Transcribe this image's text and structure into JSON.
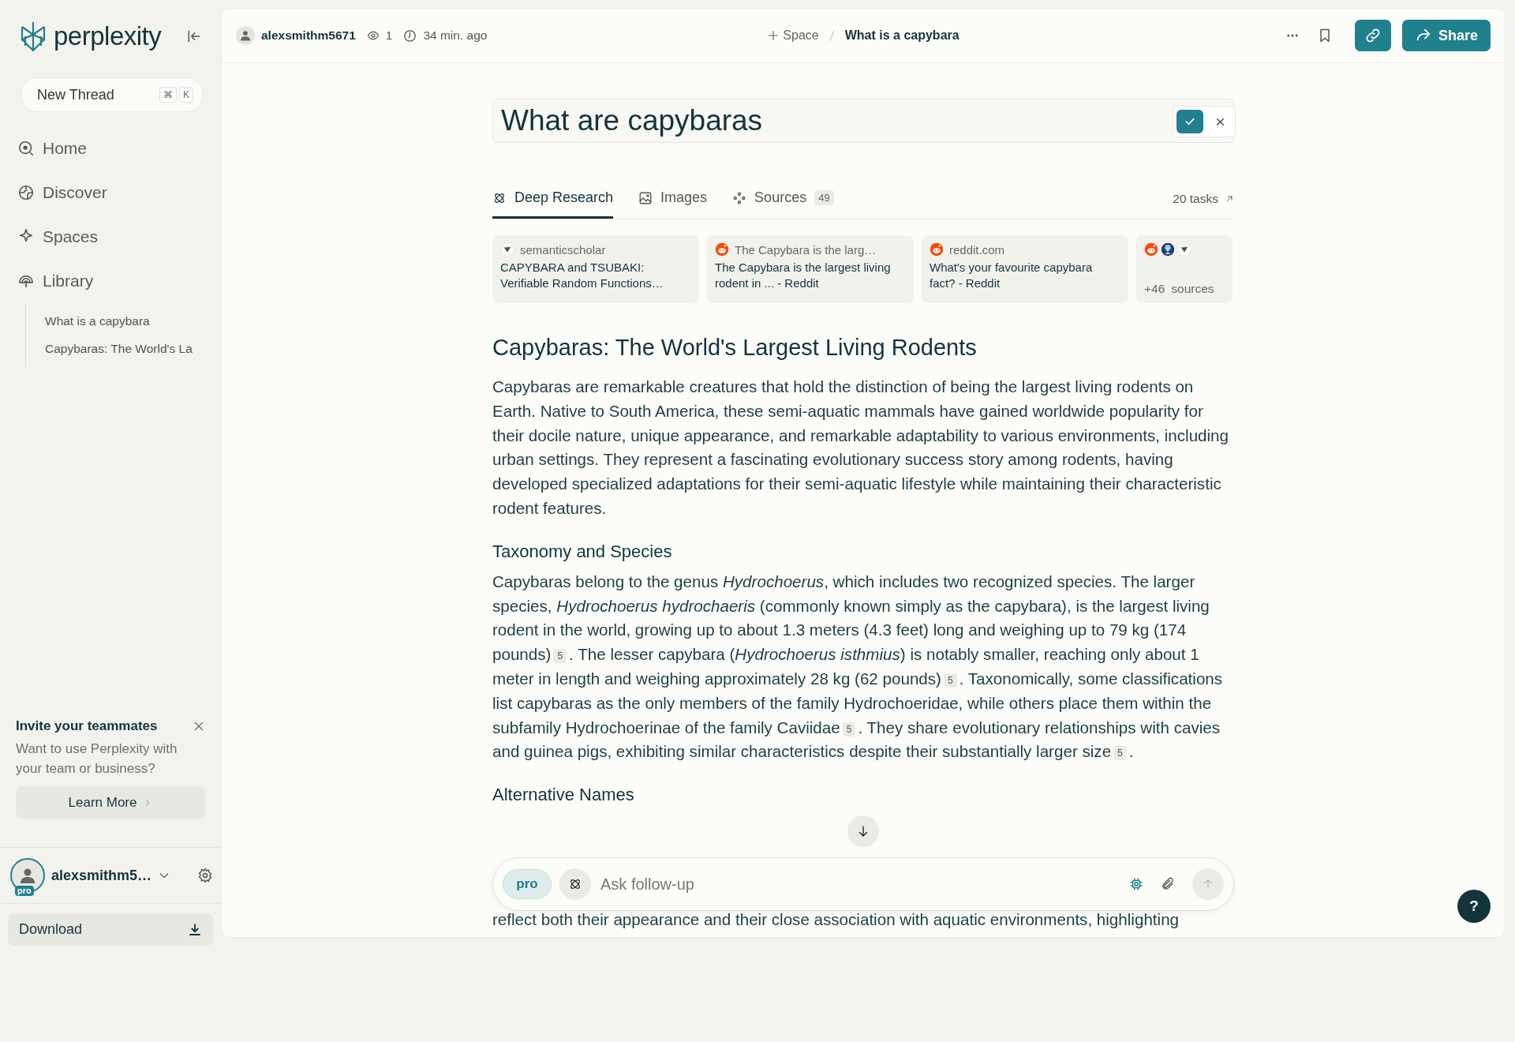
{
  "sidebar": {
    "logo": "perplexity",
    "new_thread": {
      "label": "New Thread",
      "keys": [
        "⌘",
        "K"
      ]
    },
    "nav": [
      {
        "label": "Home",
        "kind": "home"
      },
      {
        "label": "Discover",
        "kind": "discover"
      },
      {
        "label": "Spaces",
        "kind": "spaces"
      },
      {
        "label": "Library",
        "kind": "library"
      }
    ],
    "library_items": [
      "What is a capybara",
      "Capybaras: The World's La"
    ],
    "invite": {
      "title": "Invite your teammates",
      "text": "Want to use Perplexity with your team or business?",
      "button": "Learn More"
    },
    "user": {
      "name": "alexsmithm5…",
      "badge": "pro"
    },
    "download": "Download"
  },
  "header": {
    "author": "alexsmithm5671",
    "views": "1",
    "time": "34 min. ago",
    "space": "Space",
    "breadcrumb": "What is a capybara",
    "share": "Share"
  },
  "query": {
    "value": "What are capybaras"
  },
  "tabs": [
    {
      "label": "Deep Research",
      "kind": "research",
      "selected": true
    },
    {
      "label": "Images",
      "kind": "images",
      "selected": false
    },
    {
      "label": "Sources",
      "kind": "sources",
      "count": "49",
      "selected": false
    }
  ],
  "tasks": "20 tasks",
  "sources": [
    {
      "kind": "scholar",
      "site": "semanticscholar",
      "title": "CAPYBARA and TSUBAKI: Verifiable Random Functions…"
    },
    {
      "kind": "reddit",
      "site": "The Capybara is the larg…",
      "title": "The Capybara is the largest living rodent in ... - Reddit"
    },
    {
      "kind": "reddit",
      "site": "reddit.com",
      "title": "What's your favourite capybara fact? - Reddit"
    }
  ],
  "more_sources": {
    "count": "+46",
    "label": "sources"
  },
  "article": {
    "title": "Capybaras: The World's Largest Living Rodents",
    "intro": "Capybaras are remarkable creatures that hold the distinction of being the largest living rodents on Earth. Native to South America, these semi-aquatic mammals have gained worldwide popularity for their docile nature, unique appearance, and remarkable adaptability to various environments, including urban settings. They represent a fascinating evolutionary success story among rodents, having developed specialized adaptations for their semi-aquatic lifestyle while maintaining their characteristic rodent features.",
    "sections": [
      {
        "heading": "Taxonomy and Species",
        "parts": [
          {
            "text": "Capybaras belong to the genus *Hydrochoerus*, which includes two recognized species. The larger species, *Hydrochoerus hydrochaeris* (commonly known simply as the capybara), is the largest living rodent in the world, growing up to about 1.3 meters (4.3 feet) long and weighing up to 79 kg (174 pounds)"
          },
          {
            "cite": "5"
          },
          {
            "text": ". The lesser capybara (*Hydrochoerus isthmius*) is notably smaller, reaching only about 1 meter in length and weighing approximately 28 kg (62 pounds)"
          },
          {
            "cite": "5"
          },
          {
            "text": ". Taxonomically, some classifications list capybaras as the only members of the family Hydrochoeridae, while others place them within the subfamily Hydrochoerinae of the family Caviidae"
          },
          {
            "cite": "5"
          },
          {
            "text": ". They share evolutionary relationships with cavies and guinea pigs, exhibiting similar characteristics despite their substantially larger size"
          },
          {
            "cite": "5"
          },
          {
            "text": "."
          }
        ]
      },
      {
        "heading": "Alternative Names",
        "parts": [
          {
            "text": "reflect both their appearance and their close association with aquatic environments, highlighting"
          }
        ]
      }
    ]
  },
  "follow_up": {
    "badge": "pro",
    "placeholder": "Ask follow-up"
  },
  "help": "?"
}
